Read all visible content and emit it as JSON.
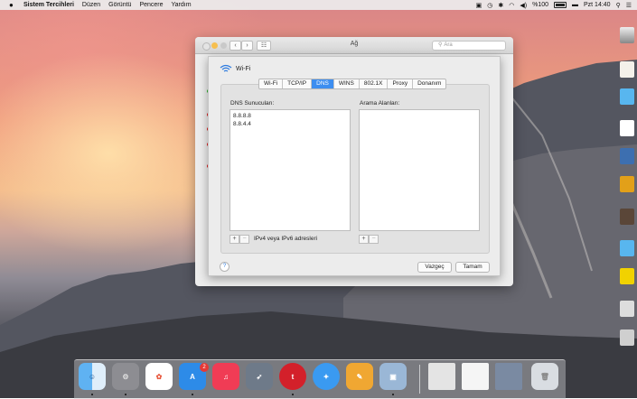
{
  "menubar": {
    "apple": "",
    "items": [
      "Sistem Tercihleri",
      "Düzen",
      "Görüntü",
      "Pencere",
      "Yardım"
    ],
    "battery": "%100",
    "clock": "Pzt 14:40"
  },
  "window": {
    "title": "Ağ",
    "search_placeholder": "Ara"
  },
  "sheet": {
    "header": "Wi-Fi",
    "tabs": [
      "Wi-Fi",
      "TCP/IP",
      "DNS",
      "WINS",
      "802.1X",
      "Proxy",
      "Donanım"
    ],
    "active_tab": "DNS",
    "dns_label": "DNS Sunucuları:",
    "dns_servers": [
      "8.8.8.8",
      "8.8.4.4"
    ],
    "search_domains_label": "Arama Alanları:",
    "address_hint": "IPv4 veya IPv6 adresleri",
    "cancel": "Vazgeç",
    "ok": "Tamam",
    "help": "?"
  },
  "dock": {
    "app_store_badge": "2"
  }
}
